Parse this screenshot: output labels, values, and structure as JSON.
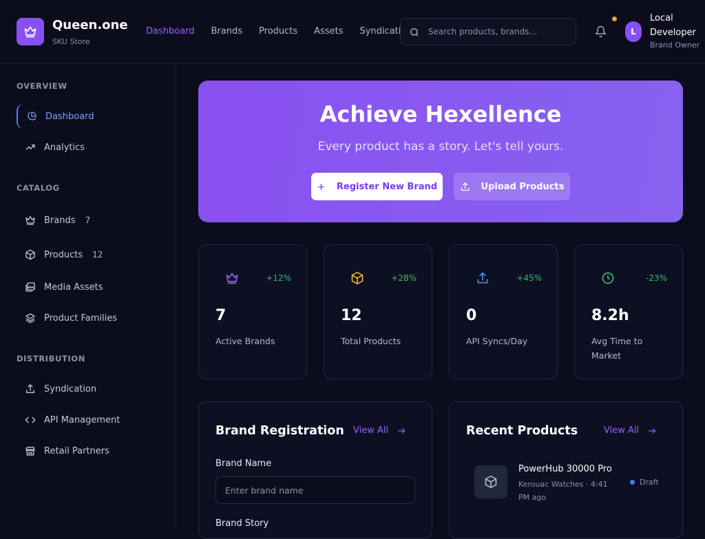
{
  "app": {
    "name": "Queen.one",
    "subtitle": "SKU Store"
  },
  "colors": {
    "accent": "#8a4ff3",
    "positive": "#3dbb6a",
    "background": "#0b0d1c"
  },
  "topnav": {
    "items": [
      {
        "label": "Dashboard",
        "active": true
      },
      {
        "label": "Brands"
      },
      {
        "label": "Products"
      },
      {
        "label": "Assets"
      },
      {
        "label": "Syndication"
      }
    ]
  },
  "search": {
    "placeholder": "Search products, brands..."
  },
  "user": {
    "initial": "L",
    "name": "Local Developer",
    "role": "Brand Owner"
  },
  "sidebar": {
    "overview": {
      "title": "OVERVIEW",
      "items": [
        {
          "label": "Dashboard",
          "icon": "pie-chart-icon",
          "active": true
        },
        {
          "label": "Analytics",
          "icon": "trending-up-icon"
        }
      ]
    },
    "catalog": {
      "title": "CATALOG",
      "items": [
        {
          "label": "Brands",
          "icon": "crown-icon",
          "count": "7"
        },
        {
          "label": "Products",
          "icon": "box-icon",
          "count": "12"
        },
        {
          "label": "Media Assets",
          "icon": "images-icon"
        },
        {
          "label": "Product Families",
          "icon": "layers-icon"
        }
      ]
    },
    "distribution": {
      "title": "DISTRIBUTION",
      "items": [
        {
          "label": "Syndication",
          "icon": "upload-icon"
        },
        {
          "label": "API Management",
          "icon": "code-icon"
        },
        {
          "label": "Retail Partners",
          "icon": "store-icon"
        }
      ]
    }
  },
  "hero": {
    "title": "Achieve Hexellence",
    "subtitle": "Every product has a story. Let's tell yours.",
    "primary_label": "Register New Brand",
    "secondary_label": "Upload Products"
  },
  "stats": [
    {
      "icon": "crown-icon",
      "change": "+12%",
      "value": "7",
      "label": "Active Brands"
    },
    {
      "icon": "box-icon",
      "change": "+28%",
      "value": "12",
      "label": "Total Products"
    },
    {
      "icon": "upload-icon",
      "change": "+45%",
      "value": "0",
      "label": "API Syncs/Day"
    },
    {
      "icon": "clock-icon",
      "change": "-23%",
      "value": "8.2h",
      "label": "Avg Time to Market"
    }
  ],
  "brand_registration": {
    "title": "Brand Registration",
    "view_all": "View All",
    "brand_name_label": "Brand Name",
    "brand_name_placeholder": "Enter brand name",
    "brand_story_label": "Brand Story"
  },
  "recent_products": {
    "title": "Recent Products",
    "view_all": "View All",
    "items": [
      {
        "name": "PowerHub 30000 Pro",
        "meta": "Kerouac Watches · 4:41 PM ago",
        "status": "Draft"
      }
    ]
  }
}
